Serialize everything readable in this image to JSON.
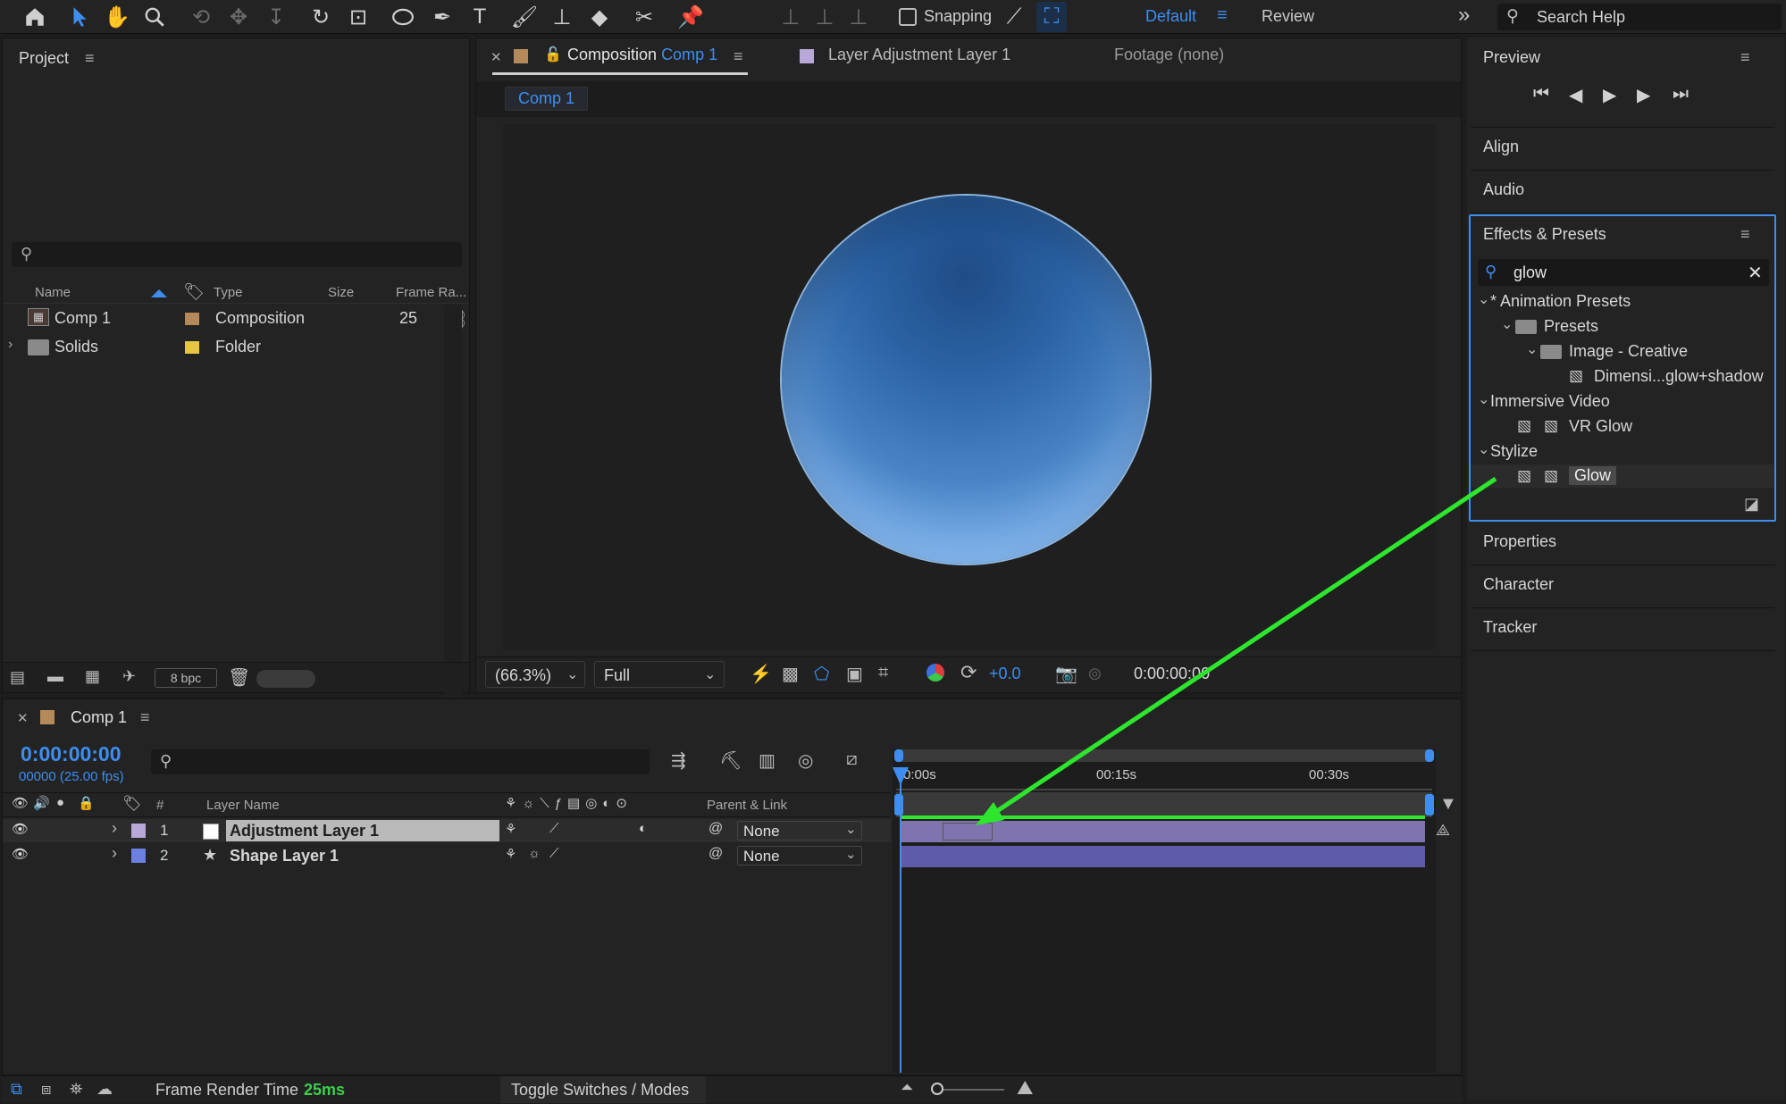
{
  "toolbar": {
    "snapping_label": "Snapping",
    "workspaces": [
      "Default",
      "Review"
    ],
    "search_placeholder": "Search Help",
    "icons": [
      "home-icon",
      "selection-icon",
      "hand-icon",
      "zoom-icon",
      "orbit-icon",
      "pan-behind-icon",
      "dolly-icon",
      "rotate-icon",
      "anchor-icon",
      "ellipse-icon",
      "pen-icon",
      "type-icon",
      "brush-icon",
      "clone-stamp-icon",
      "eraser-icon",
      "roto-brush-icon",
      "puppet-pin-icon"
    ]
  },
  "project": {
    "title": "Project",
    "columns": [
      "Name",
      "Type",
      "Size",
      "Frame Ra..."
    ],
    "items": [
      {
        "name": "Comp 1",
        "type": "Composition",
        "size": "",
        "frame_rate": "25",
        "label_color": "#b58a5a"
      },
      {
        "name": "Solids",
        "type": "Folder",
        "size": "",
        "frame_rate": "",
        "label_color": "#e6c640"
      }
    ],
    "bpc": "8 bpc"
  },
  "viewer": {
    "tabs": [
      {
        "prefix": "Composition",
        "name": "Comp 1"
      },
      {
        "prefix": "Layer",
        "name": "Adjustment Layer 1"
      },
      {
        "prefix": "Footage",
        "name": "(none)"
      }
    ],
    "breadcrumb": "Comp 1",
    "zoom": "(66.3%)",
    "resolution": "Full",
    "exposure": "+0.0",
    "timecode": "0:00:00:00"
  },
  "right": {
    "preview_title": "Preview",
    "align": "Align",
    "audio": "Audio",
    "effects_title": "Effects & Presets",
    "search_value": "glow",
    "tree": [
      {
        "label": "* Animation Presets",
        "level": 0,
        "kind": "group"
      },
      {
        "label": "Presets",
        "level": 1,
        "kind": "folder"
      },
      {
        "label": "Image - Creative",
        "level": 2,
        "kind": "folder"
      },
      {
        "label": "Dimensi...glow+shadow",
        "level": 3,
        "kind": "preset"
      },
      {
        "label": "Immersive Video",
        "level": 0,
        "kind": "group"
      },
      {
        "label": "VR Glow",
        "level": 1,
        "kind": "effect"
      },
      {
        "label": "Stylize",
        "level": 0,
        "kind": "group"
      },
      {
        "label": "Glow",
        "level": 1,
        "kind": "effect",
        "selected": true
      }
    ],
    "properties": "Properties",
    "character": "Character",
    "tracker": "Tracker"
  },
  "timeline": {
    "comp_name": "Comp 1",
    "timecode": "0:00:00:00",
    "frames": "00000 (25.00 fps)",
    "columns": {
      "num": "#",
      "layer_name": "Layer Name",
      "parent": "Parent & Link"
    },
    "ruler": [
      "0:00s",
      "00:15s",
      "00:30s"
    ],
    "layers": [
      {
        "num": "1",
        "name": "Adjustment Layer 1",
        "parent": "None",
        "color": "#b7a8d8",
        "selected": true
      },
      {
        "num": "2",
        "name": "Shape Layer 1",
        "parent": "None",
        "color": "#6d7fe0",
        "selected": false
      }
    ],
    "footer": {
      "render_label": "Frame Render Time",
      "render_value": "25ms",
      "toggle": "Toggle Switches / Modes"
    }
  },
  "colors": {
    "accent": "#3d8ef0",
    "annotation_arrow": "#2ee62e",
    "adjustment_bar": "#7f74ad",
    "shape_bar": "#5e5ba8"
  }
}
